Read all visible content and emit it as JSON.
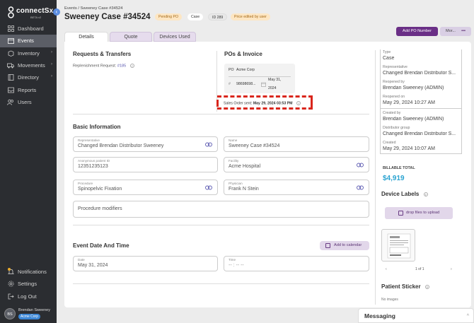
{
  "app": {
    "logo_text": "connectSx",
    "logo_sub": "BETA v2"
  },
  "sidebar": {
    "items": [
      {
        "label": "Dashboard",
        "icon": "grid-icon"
      },
      {
        "label": "Events",
        "icon": "calendar-icon",
        "active": true
      },
      {
        "label": "Inventory",
        "icon": "box-icon",
        "chevron": true
      },
      {
        "label": "Movements",
        "icon": "truck-icon",
        "chevron": true
      },
      {
        "label": "Directory",
        "icon": "book-icon",
        "chevron": true
      },
      {
        "label": "Reports",
        "icon": "inbox-icon"
      },
      {
        "label": "Users",
        "icon": "users-icon"
      }
    ],
    "bottom_items": [
      {
        "label": "Notifications",
        "icon": "bell-icon"
      },
      {
        "label": "Settings",
        "icon": "gear-icon"
      },
      {
        "label": "Log Out",
        "icon": "logout-icon"
      }
    ],
    "user": {
      "initials": "BS",
      "name": "Brendan Sweeney",
      "org": "Acme Corp"
    }
  },
  "header": {
    "breadcrumb": "Events / Sweeney Case #34524",
    "title": "Sweeney Case #34524",
    "tags": {
      "status": "Pending PO",
      "type": "Case",
      "id": "ID 289",
      "price": "Price edited by user"
    },
    "add_po_button": "Add PO Number",
    "more_button": "Mor...",
    "more_dots": "•••"
  },
  "tabs": [
    {
      "label": "Details",
      "active": true
    },
    {
      "label": "Quote"
    },
    {
      "label": "Devices Used"
    }
  ],
  "requests": {
    "title": "Requests & Transfers",
    "replenishment_label": "Replenishment Request:",
    "replenishment_link": "#185",
    "info_glyph": "?"
  },
  "po_invoice": {
    "title": "POs & Invoice",
    "po_label": "PO",
    "po_vendor": "Acme Corp",
    "po_number": "98698698...",
    "po_date_line1": "May 31,",
    "po_date_line2": "2024",
    "so_label": "Sales Order sent:",
    "so_date": "May 29, 2024 03:53 PM"
  },
  "basic_info": {
    "title": "Basic Information",
    "fields": {
      "representative": {
        "label": "Representative",
        "value": "Changed Brendan Distributor Sweeney"
      },
      "name": {
        "label": "Name",
        "value": "Sweeney Case #34524"
      },
      "patient_id": {
        "label": "Anonymous patient ID",
        "value": "12351235123"
      },
      "facility": {
        "label": "Facility",
        "value": "Acme Hospital"
      },
      "procedure": {
        "label": "Procedure",
        "value": "Spinopelvic Fixation"
      },
      "physician": {
        "label": "Physician",
        "value": "Frank N Stein"
      },
      "modifiers": {
        "placeholder": "Procedure modifiers"
      }
    }
  },
  "event_datetime": {
    "title": "Event Date And Time",
    "add_calendar": "Add to calendar",
    "date_label": "Date",
    "date_value": "May 31, 2024",
    "time_label": "Time",
    "time_placeholder": "-- : -- --"
  },
  "rail": {
    "type_label": "Type",
    "type_value": "Case",
    "rep_label": "Representative",
    "rep_value": "Changed Brendan Distributor S...",
    "reopened_by_label": "Reopened by",
    "reopened_by_value": "Brendan Sweeney (ADMIN)",
    "reopened_on_label": "Reopened on",
    "reopened_on_value": "May 29, 2024 10:27 AM",
    "created_by_label": "Created by",
    "created_by_value": "Brendan Sweeney (ADMIN)",
    "dist_group_label": "Distributor group",
    "dist_group_value": "Changed Brendan Distributor S...",
    "created_label": "Created",
    "created_value": "May 29, 2024 10:07 AM",
    "billable_label": "BILLABLE TOTAL",
    "billable_value": "$4,919",
    "device_labels_title": "Device Labels",
    "drop_files": "drop files to upload",
    "pager_text": "1 of 1",
    "pager_prev": "‹",
    "pager_next": "›",
    "patient_sticker_title": "Patient Sticker",
    "no_images": "No images"
  },
  "messaging": {
    "title": "Messaging",
    "chevron": "^"
  }
}
